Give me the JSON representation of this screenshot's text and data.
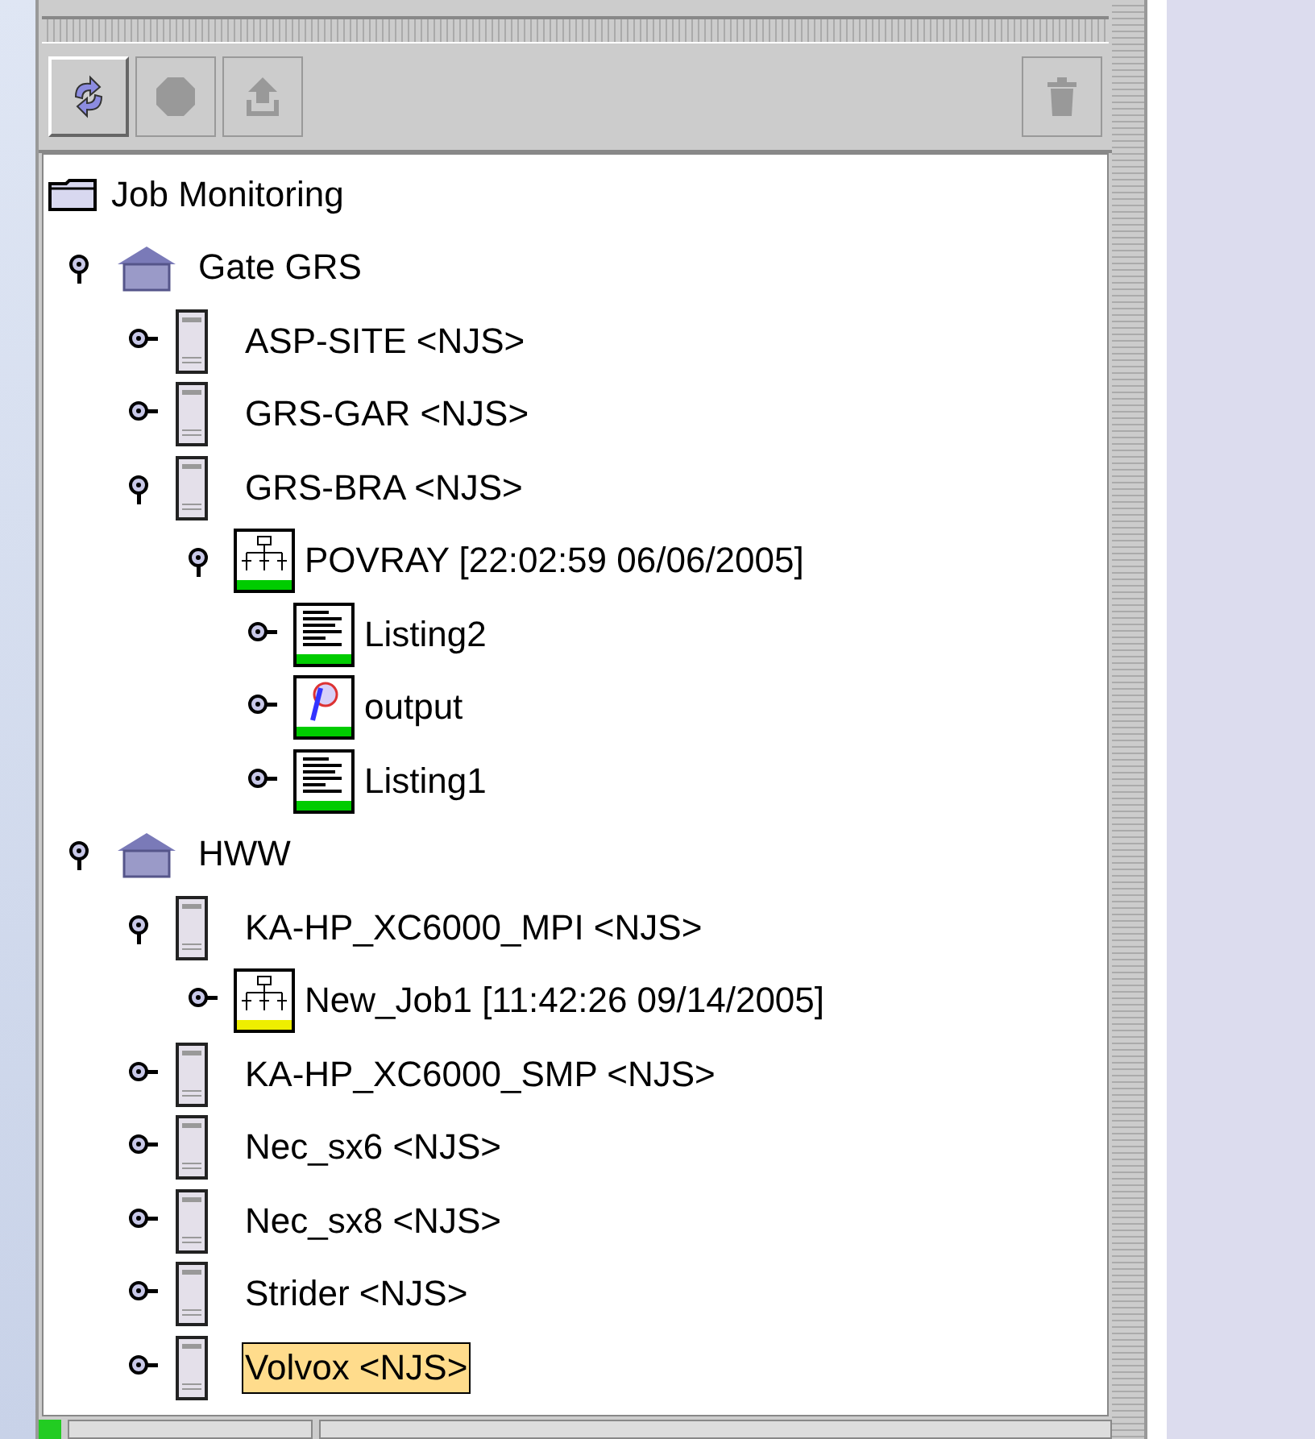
{
  "toolbar": [
    {
      "kind": "refresh",
      "disabled": false
    },
    {
      "kind": "stop",
      "disabled": true
    },
    {
      "kind": "upload",
      "disabled": true
    },
    {
      "kind": "delete",
      "disabled": true
    }
  ],
  "tree": {
    "label": "Job Monitoring",
    "kind": "folder",
    "children": [
      {
        "label": "Gate GRS",
        "kind": "site",
        "expanded": true,
        "selected": false,
        "children": [
          {
            "label": "ASP-SITE <NJS>",
            "kind": "server",
            "expanded": false,
            "selected": false
          },
          {
            "label": "GRS-GAR <NJS>",
            "kind": "server",
            "expanded": false,
            "selected": false
          },
          {
            "label": "GRS-BRA <NJS>",
            "kind": "server",
            "expanded": true,
            "selected": false,
            "children": [
              {
                "label": "POVRAY [22:02:59 06/06/2005]",
                "kind": "job",
                "color": "#00cc00",
                "expanded": true,
                "selected": false,
                "children": [
                  {
                    "label": "Listing2",
                    "kind": "listing",
                    "color": "#00cc00",
                    "expanded": false,
                    "selected": false
                  },
                  {
                    "label": "output",
                    "kind": "output",
                    "color": "#00cc00",
                    "expanded": false,
                    "selected": false
                  },
                  {
                    "label": "Listing1",
                    "kind": "listing",
                    "color": "#00cc00",
                    "expanded": false,
                    "selected": false
                  }
                ]
              }
            ]
          }
        ]
      },
      {
        "label": "HWW",
        "kind": "site",
        "expanded": true,
        "selected": false,
        "children": [
          {
            "label": "KA-HP_XC6000_MPI <NJS>",
            "kind": "server",
            "expanded": true,
            "selected": false,
            "children": [
              {
                "label": "New_Job1 [11:42:26 09/14/2005]",
                "kind": "job",
                "color": "#eeee00",
                "expanded": false,
                "selected": false
              }
            ]
          },
          {
            "label": "KA-HP_XC6000_SMP <NJS>",
            "kind": "server",
            "expanded": false,
            "selected": false
          },
          {
            "label": "Nec_sx6 <NJS>",
            "kind": "server",
            "expanded": false,
            "selected": false
          },
          {
            "label": "Nec_sx8 <NJS>",
            "kind": "server",
            "expanded": false,
            "selected": false
          },
          {
            "label": "Strider <NJS>",
            "kind": "server",
            "expanded": false,
            "selected": false
          },
          {
            "label": "Volvox <NJS>",
            "kind": "server",
            "expanded": false,
            "selected": true
          }
        ]
      }
    ]
  }
}
